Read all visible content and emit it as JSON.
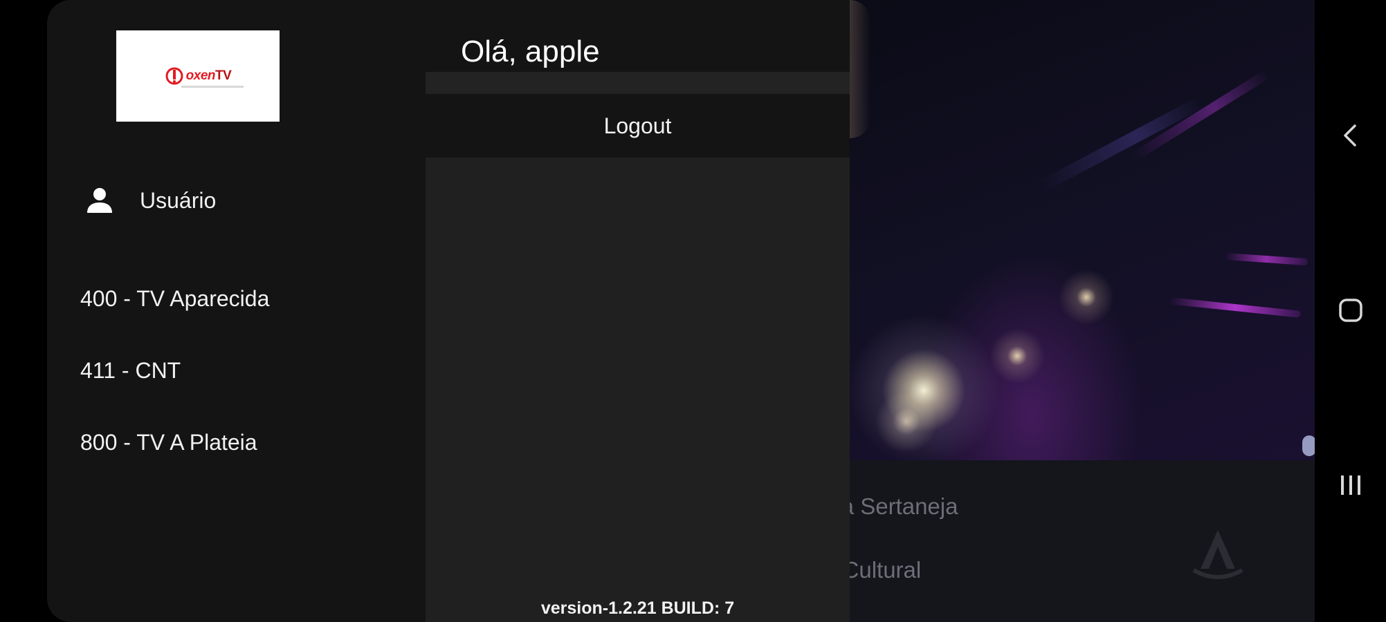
{
  "drawer": {
    "logo_alt": "oxenTV",
    "logo_text_a": "oxen",
    "logo_text_b": "TV",
    "user_label": "Usuário",
    "channels": [
      {
        "label": "400 - TV Aparecida"
      },
      {
        "label": "411 - CNT"
      },
      {
        "label": "800 - TV A Plateia"
      }
    ]
  },
  "panel": {
    "greeting": "Olá, apple",
    "logout_label": "Logout",
    "version": "version-1.2.21 BUILD: 7"
  },
  "background": {
    "list_items": [
      "ida Sertaneja",
      "n Cultural"
    ]
  },
  "nav": {
    "back_icon": "chevron-left-icon",
    "home_icon": "home-square-icon",
    "recents_icon": "recents-bars-icon"
  },
  "colors": {
    "drawer_bg": "#141414",
    "panel_bg": "#202020",
    "logo_red": "#e21b23",
    "text": "#f2f2f2"
  }
}
